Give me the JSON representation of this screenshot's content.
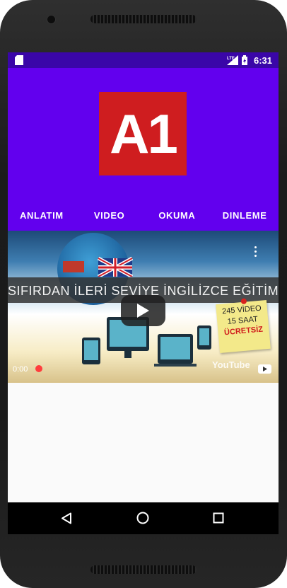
{
  "status_bar": {
    "time": "6:31",
    "network_label": "LTE",
    "icons": [
      "sd-card-icon",
      "signal-icon",
      "battery-icon"
    ]
  },
  "logo": {
    "text": "A1",
    "color": "#cf1d1f"
  },
  "tabs": [
    {
      "label": "ANLATIM"
    },
    {
      "label": "VIDEO"
    },
    {
      "label": "OKUMA"
    },
    {
      "label": "DINLEME"
    }
  ],
  "video": {
    "title": "SIFIRDAN İLERİ SEVİYE İNGİLİZCE EĞİTİMİ",
    "note_line1": "245 VİDEO",
    "note_line2": "15 SAAT",
    "note_line3": "ÜCRETSİZ",
    "current_time": "0:00",
    "watermark": "YouTube"
  },
  "colors": {
    "status_bar": "#3a06a8",
    "header": "#6200ee",
    "nav_bar": "#000000"
  }
}
